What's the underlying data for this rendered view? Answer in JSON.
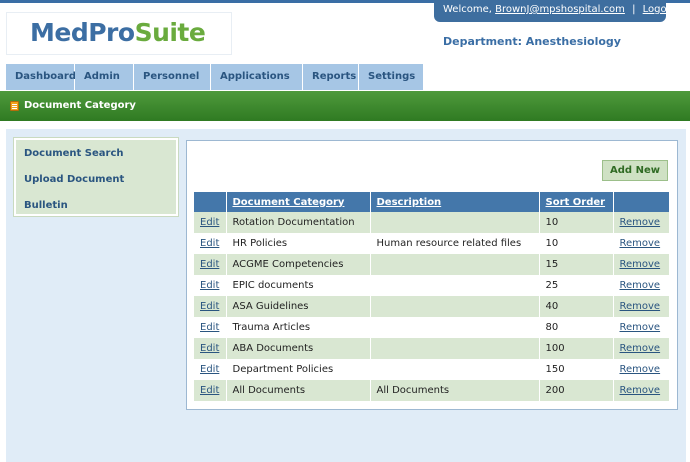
{
  "brand": {
    "part1": "MedPro",
    "part2": "Suite"
  },
  "header": {
    "welcome_prefix": "Welcome,",
    "user_email": "BrownJ@mpshospital.com",
    "separator": "|",
    "logout_label": "Logout",
    "department": "Department: Anesthesiology"
  },
  "nav": {
    "tabs": [
      {
        "label": "Dashboard"
      },
      {
        "label": "Admin"
      },
      {
        "label": "Personnel"
      },
      {
        "label": "Applications"
      },
      {
        "label": "Reports"
      },
      {
        "label": "Settings"
      }
    ]
  },
  "page": {
    "title": "Document Category",
    "title_icon": "document-icon"
  },
  "sidebar": {
    "links": [
      {
        "label": "Document Search"
      },
      {
        "label": "Upload Document"
      },
      {
        "label": "Bulletin"
      }
    ]
  },
  "toolbar": {
    "add_new_label": "Add New"
  },
  "table": {
    "columns": [
      "",
      "Document Category",
      "Description",
      "Sort Order",
      ""
    ],
    "edit_label": "Edit",
    "remove_label": "Remove",
    "rows": [
      {
        "category": "Rotation Documentation",
        "description": "",
        "sort_order": "10"
      },
      {
        "category": "HR Policies",
        "description": "Human resource related files",
        "sort_order": "10"
      },
      {
        "category": "ACGME Competencies",
        "description": "",
        "sort_order": "15"
      },
      {
        "category": "EPIC documents",
        "description": "",
        "sort_order": "25"
      },
      {
        "category": "ASA Guidelines",
        "description": "",
        "sort_order": "40"
      },
      {
        "category": "Trauma Articles",
        "description": "",
        "sort_order": "80"
      },
      {
        "category": "ABA Documents",
        "description": "",
        "sort_order": "100"
      },
      {
        "category": "Department Policies",
        "description": "",
        "sort_order": "150"
      },
      {
        "category": "All Documents",
        "description": "All Documents",
        "sort_order": "200"
      }
    ]
  },
  "colors": {
    "primary_blue": "#3a6ea5",
    "tab_blue": "#a6c6e5",
    "title_green": "#2f7a22",
    "row_green": "#d9e7d2",
    "content_bg": "#e0ecf7"
  }
}
